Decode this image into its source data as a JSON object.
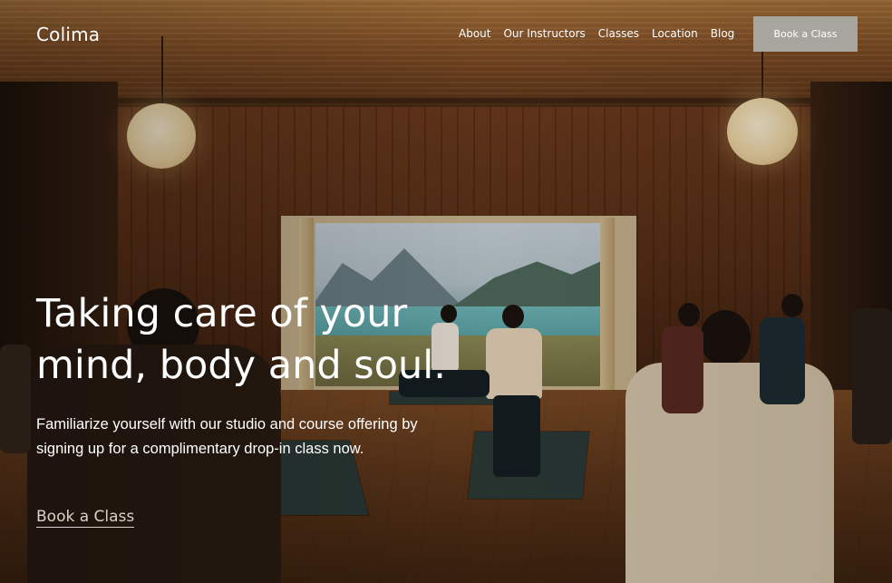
{
  "brand": {
    "logo_text": "Colima"
  },
  "nav": {
    "items": [
      {
        "label": "About"
      },
      {
        "label": "Our Instructors"
      },
      {
        "label": "Classes"
      },
      {
        "label": "Location"
      },
      {
        "label": "Blog"
      }
    ],
    "cta_label": "Book a Class"
  },
  "hero": {
    "title": "Taking care of your mind, body and soul.",
    "subtitle": "Familiarize yourself with our studio and course offering by signing up for a complimentary drop-in class now.",
    "cta_label": "Book a Class",
    "background": "yoga-studio-photo"
  },
  "colors": {
    "header_button_bg": "#a8a59f",
    "text": "#ffffff",
    "cta_link": "#d9d2c8"
  }
}
